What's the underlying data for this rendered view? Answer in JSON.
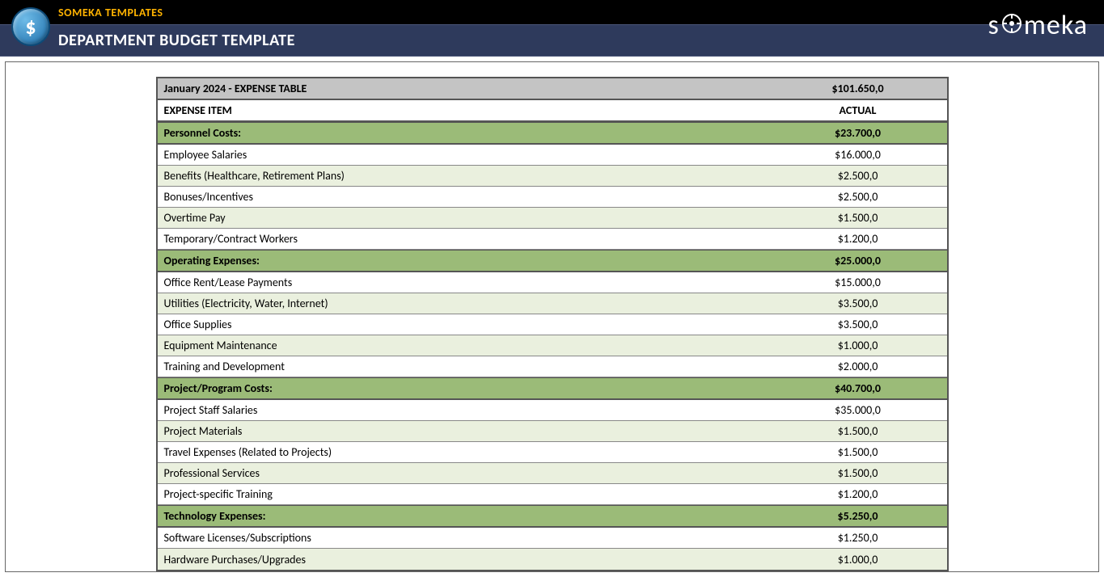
{
  "header": {
    "brand": "SOMEKA TEMPLATES",
    "title": "DEPARTMENT BUDGET TEMPLATE",
    "logo_text": "someka"
  },
  "table": {
    "title": "January 2024 - EXPENSE TABLE",
    "total": "$101.650,0",
    "col_item": "EXPENSE ITEM",
    "col_actual": "ACTUAL",
    "groups": [
      {
        "name": "Personnel Costs:",
        "subtotal": "$23.700,0",
        "items": [
          {
            "label": "Employee Salaries",
            "value": "$16.000,0"
          },
          {
            "label": "Benefits (Healthcare, Retirement Plans)",
            "value": "$2.500,0"
          },
          {
            "label": "Bonuses/Incentives",
            "value": "$2.500,0"
          },
          {
            "label": "Overtime Pay",
            "value": "$1.500,0"
          },
          {
            "label": "Temporary/Contract Workers",
            "value": "$1.200,0"
          }
        ]
      },
      {
        "name": "Operating Expenses:",
        "subtotal": "$25.000,0",
        "items": [
          {
            "label": "Office Rent/Lease Payments",
            "value": "$15.000,0"
          },
          {
            "label": "Utilities (Electricity, Water, Internet)",
            "value": "$3.500,0"
          },
          {
            "label": "Office Supplies",
            "value": "$3.500,0"
          },
          {
            "label": "Equipment Maintenance",
            "value": "$1.000,0"
          },
          {
            "label": "Training and Development",
            "value": "$2.000,0"
          }
        ]
      },
      {
        "name": "Project/Program Costs:",
        "subtotal": "$40.700,0",
        "items": [
          {
            "label": "Project Staff Salaries",
            "value": "$35.000,0"
          },
          {
            "label": "Project Materials",
            "value": "$1.500,0"
          },
          {
            "label": "Travel Expenses (Related to Projects)",
            "value": "$1.500,0"
          },
          {
            "label": "Professional Services",
            "value": "$1.500,0"
          },
          {
            "label": "Project-specific Training",
            "value": "$1.200,0"
          }
        ]
      },
      {
        "name": "Technology Expenses:",
        "subtotal": "$5.250,0",
        "items": [
          {
            "label": "Software Licenses/Subscriptions",
            "value": "$1.250,0"
          },
          {
            "label": "Hardware Purchases/Upgrades",
            "value": "$1.000,0"
          }
        ]
      }
    ]
  }
}
